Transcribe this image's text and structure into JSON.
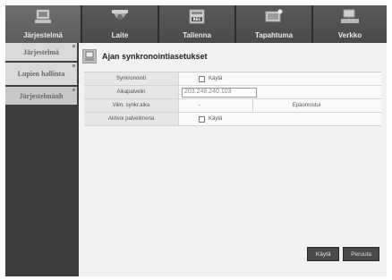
{
  "nav": {
    "tabs": [
      {
        "label": "Järjestelmä",
        "icon": "system-icon",
        "active": true
      },
      {
        "label": "Laite",
        "icon": "camera-icon",
        "active": false
      },
      {
        "label": "Tallenna",
        "icon": "record-icon",
        "active": false
      },
      {
        "label": "Tapahtuma",
        "icon": "event-icon",
        "active": false
      },
      {
        "label": "Verkko",
        "icon": "network-icon",
        "active": false
      }
    ]
  },
  "sidebar": {
    "items": [
      {
        "label": "Järjestelmä"
      },
      {
        "label": "Lupien hallinta"
      },
      {
        "label": "Järjestelmänh"
      }
    ]
  },
  "panel": {
    "title": "Ajan synkronointiasetukset"
  },
  "form": {
    "sync_label": "Synkronointi",
    "sync_check_label": "Käytä",
    "server_label": "Aikapalvelin",
    "server_value": "203.248.240.103",
    "last_sync_label": "Viim. synkr.aika",
    "last_sync_value": "-",
    "last_sync_status": "Epäonnistui",
    "active_server_label": "Aktivoi palvelimena",
    "active_server_check_label": "Käytä"
  },
  "buttons": {
    "apply": "Käytä",
    "cancel": "Peruuta"
  }
}
